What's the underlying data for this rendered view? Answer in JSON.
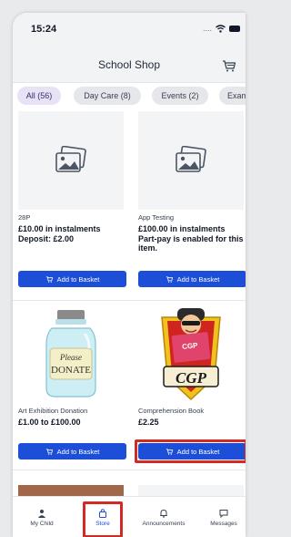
{
  "status_bar": {
    "time": "15:24"
  },
  "header": {
    "title": "School Shop",
    "cart_icon": "cart-icon"
  },
  "filters": [
    {
      "label": "All (56)",
      "active": true
    },
    {
      "label": "Day Care (8)",
      "active": false
    },
    {
      "label": "Events (2)",
      "active": false
    },
    {
      "label": "Exam",
      "active": false
    }
  ],
  "products": [
    {
      "name": "28P",
      "price": "£10.00 in instalments\nDeposit: £2.00",
      "image": "image-placeholder-icon",
      "button": "Add to Basket"
    },
    {
      "name": "App Testing",
      "price": "£100.00 in instalments\nPart-pay is enabled for this item.",
      "image": "image-placeholder-icon",
      "button": "Add to Basket"
    },
    {
      "name": "Art Exhibition Donation",
      "price": "£1.00 to £100.00",
      "image": "donation-jar-image",
      "image_text": "Please\nDONATE",
      "button": "Add to Basket"
    },
    {
      "name": "Comprehension Book",
      "price": "£2.25",
      "image": "cgp-book-image",
      "image_text": "CGP",
      "button": "Add to Basket"
    }
  ],
  "tab_bar": [
    {
      "label": "My Child",
      "icon": "person-icon",
      "active": false
    },
    {
      "label": "Store",
      "icon": "bag-icon",
      "active": true
    },
    {
      "label": "Announcements",
      "icon": "bell-icon",
      "active": false
    },
    {
      "label": "Messages",
      "icon": "chat-icon",
      "active": false
    }
  ],
  "colors": {
    "primary": "#1d4ed8",
    "highlight": "#d42a24",
    "chip_active": "#e8e2f6"
  }
}
